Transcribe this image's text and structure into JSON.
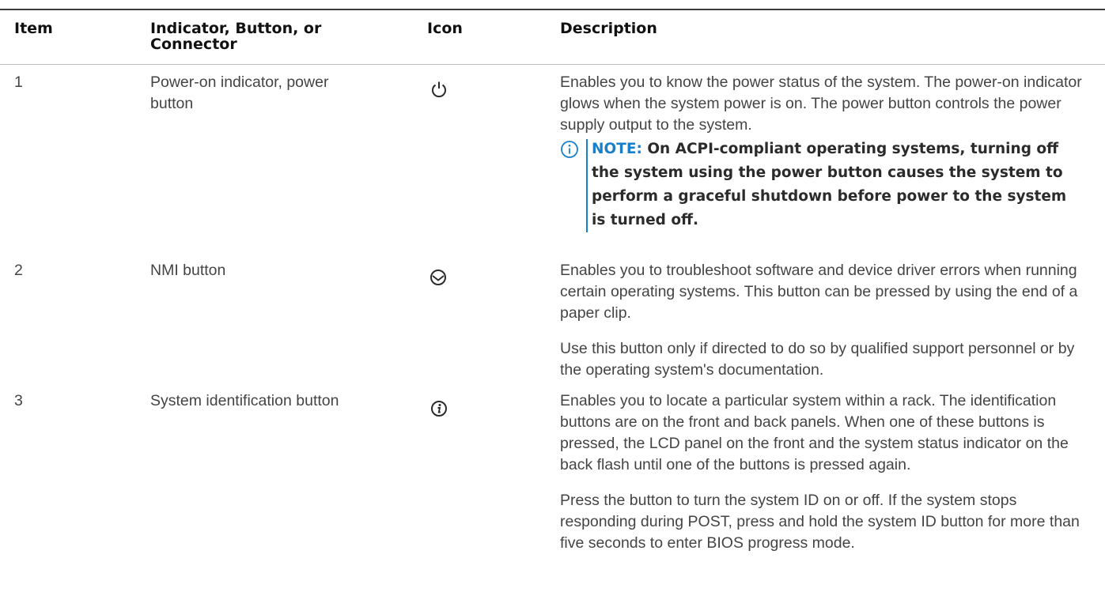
{
  "header": {
    "item": "Item",
    "indicator": "Indicator, Button, or Connector",
    "icon": "Icon",
    "description": "Description"
  },
  "rows": [
    {
      "item": "1",
      "name": "Power-on indicator, power button",
      "icon": "power-icon",
      "description": [
        "Enables you to know the power status of the system. The power-on indicator glows when the system power is on. The power button controls the power supply output to the system."
      ],
      "note": {
        "label": "NOTE:",
        "text": "On ACPI-compliant operating systems, turning off the system using the power button causes the system to perform a graceful shutdown before power to the system is turned off."
      }
    },
    {
      "item": "2",
      "name": "NMI button",
      "icon": "nmi-icon",
      "description": [
        "Enables you to troubleshoot software and device driver errors when running certain operating systems. This button can be pressed by using the end of a paper clip.",
        "Use this button only if directed to do so by qualified support personnel or by the operating system's documentation."
      ]
    },
    {
      "item": "3",
      "name": "System identification button",
      "icon": "system-id-icon",
      "description": [
        "Enables you to locate a particular system within a rack. The identification buttons are on the front and back panels. When one of these buttons is pressed, the LCD panel on the front and the system status indicator on the back flash until one of the buttons is pressed again.",
        "Press the button to turn the system ID on or off. If the system stops responding during POST, press and hold the system ID button for more than five seconds to enter BIOS progress mode."
      ]
    }
  ],
  "colors": {
    "note_accent": "#1a7fc9",
    "text": "#444444",
    "header_text": "#111111"
  }
}
